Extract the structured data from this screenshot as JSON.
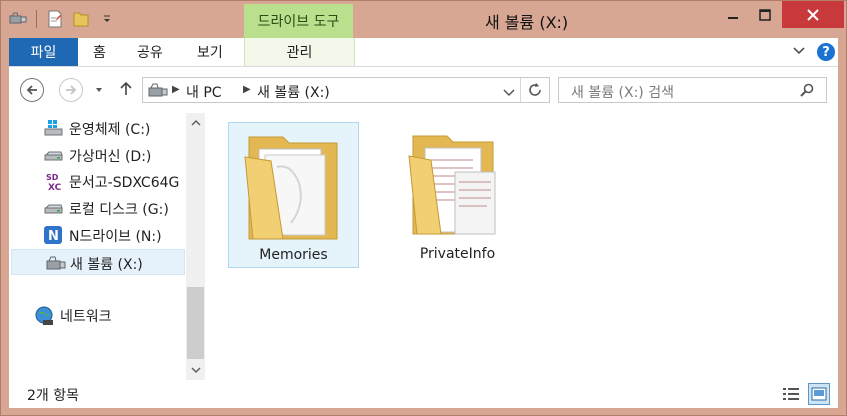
{
  "window": {
    "title": "새 볼륨 (X:)",
    "contextual_tab_group": "드라이브 도구"
  },
  "ribbon": {
    "tabs": [
      "파일",
      "홈",
      "공유",
      "보기"
    ],
    "contextual_tab": "관리"
  },
  "address": {
    "crumbs": [
      "내 PC",
      "새 볼륨 (X:)"
    ]
  },
  "search": {
    "placeholder": "새 볼륨 (X:) 검색"
  },
  "sidebar": {
    "items": [
      {
        "label": "운영체제 (C:)",
        "icon": "windows-drive-icon"
      },
      {
        "label": "가상머신 (D:)",
        "icon": "drive-icon"
      },
      {
        "label": "문서고-SDXC64G",
        "icon": "sdxc-card-icon"
      },
      {
        "label": "로컬 디스크 (G:)",
        "icon": "drive-icon"
      },
      {
        "label": "N드라이브 (N:)",
        "icon": "ndrive-icon"
      },
      {
        "label": "새 볼륨 (X:)",
        "icon": "usb-drive-icon",
        "selected": true
      },
      {
        "label": "네트워크",
        "icon": "network-icon"
      }
    ]
  },
  "files": [
    {
      "name": "Memories",
      "type": "folder",
      "selected": true
    },
    {
      "name": "PrivateInfo",
      "type": "folder",
      "selected": false
    }
  ],
  "status": {
    "item_count": "2개 항목"
  },
  "colors": {
    "frame": "#d7a793",
    "file_tab": "#1f68b3",
    "contextual_tab": "#b8e08d",
    "close_button": "#c8393b",
    "selection": "#e5f3fb"
  }
}
